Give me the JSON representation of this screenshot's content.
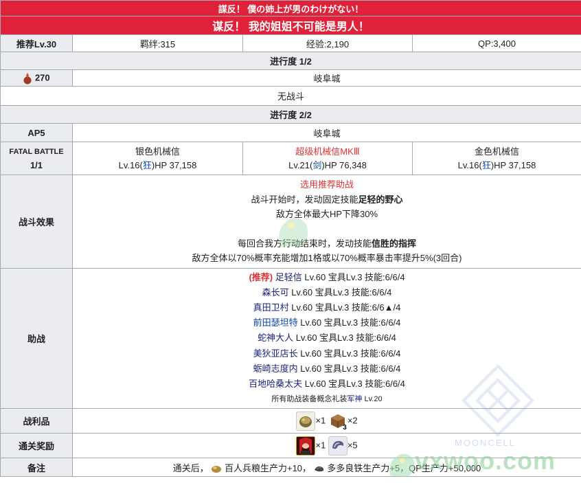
{
  "header": {
    "title_jp": "謀反！ 僕の姉上が男のわけがない！",
    "title_cn": "谋反！ 我的姐姐不可能是男人！"
  },
  "info": {
    "rec_lv": "推荐Lv.30",
    "bond": "羁绊:315",
    "exp": "经验:2,190",
    "qp": "QP:3,400"
  },
  "progress1": {
    "title": "进行度 1/2",
    "cost": "270",
    "location": "岐阜城",
    "no_battle": "无战斗"
  },
  "progress2": {
    "title": "进行度 2/2",
    "ap": "AP5",
    "location": "岐阜城",
    "fatal_label": "FATAL BATTLE",
    "wave": "1/1",
    "enemies": [
      {
        "name": "银色机械信",
        "lv": "Lv.16(",
        "class": "狂",
        "hp": ")HP 37,158"
      },
      {
        "name": "超级机械信MKⅢ",
        "lv": "Lv.21(",
        "class": "剑",
        "hp": ")HP 76,348"
      },
      {
        "name": "金色机械信",
        "lv": "Lv.16(",
        "class": "狂",
        "hp": ")HP 37,158"
      }
    ]
  },
  "effects": {
    "label": "战斗效果",
    "line1": "选用推荐助战",
    "line2a": "战斗开始时，发动固定技能",
    "line2b": "足轻的野心",
    "line3": "敌方全体最大HP下降30%",
    "line4a": "每回合我方行动结束时，发动技能",
    "line4b": "信胜的指挥",
    "line5": "敌方全体以70%概率充能增加1格或以70%概率暴击率提升5%(3回合)"
  },
  "support": {
    "label": "助战",
    "rec_tag": "(推荐)",
    "rows": [
      {
        "name": "足轻信",
        "rest": " Lv.60 宝具Lv.3 技能:6/6/4"
      },
      {
        "name": "森长可",
        "rest": " Lv.60 宝具Lv.3 技能:6/6/4"
      },
      {
        "name": "真田卫村",
        "rest": " Lv.60 宝具Lv.3 技能:6/6▲/4"
      },
      {
        "name": "前田瑟坦特",
        "rest": " Lv.60 宝具Lv.3 技能:6/6/4"
      },
      {
        "name": "蛇神大人",
        "rest": " Lv.60 宝具Lv.3 技能:6/6/4"
      },
      {
        "name": "美狄亚店长",
        "rest": " Lv.60 宝具Lv.3 技能:6/6/4"
      },
      {
        "name": "蛎崎志度内",
        "rest": " Lv.60 宝具Lv.3 技能:6/6/4"
      },
      {
        "name": "百地哈桑太夫",
        "rest": " Lv.60 宝具Lv.3 技能:6/6/4"
      }
    ],
    "note_a": "所有助战装备概念礼装",
    "note_ce": "军神",
    "note_b": " Lv.20"
  },
  "drops": {
    "label": "战利品",
    "item1_count": "×1",
    "item2_badge": "3",
    "item2_count": "×2"
  },
  "rewards": {
    "label": "通关奖励",
    "item1_count": "×1",
    "item2_count": "×5"
  },
  "notes": {
    "label": "备注",
    "prefix": "通关后，",
    "t1": "百人兵粮生产力+10，",
    "t2": "多多良铁生产力+5，QP生产力+50,000"
  },
  "watermark": {
    "brand": "MOONCELL",
    "site": "vxwoo.com"
  },
  "colors": {
    "header_red": "#e0213a",
    "label_gray": "#eaecf0",
    "border": "#a2a9b1",
    "link_blue": "#0645ad",
    "alert_red": "#d33"
  }
}
